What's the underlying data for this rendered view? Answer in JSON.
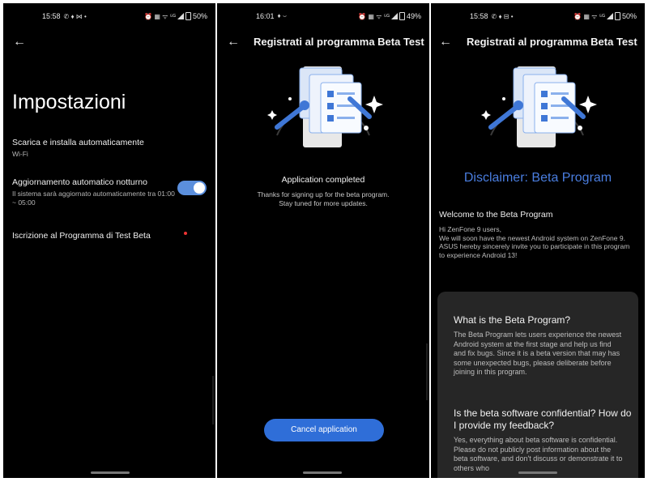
{
  "panel1": {
    "status": {
      "time": "15:58",
      "left_icons": "✆ ♦ ⋈ •",
      "right_icons": "⏰ ▦ ᯤ ⁵ᴳ",
      "battery": "50%"
    },
    "page_title": "Impostazioni",
    "settings": [
      {
        "title": "Scarica e installa automaticamente",
        "subtitle": "Wi-Fi"
      },
      {
        "title": "Aggiornamento automatico notturno",
        "subtitle": "Il sistema sarà aggiornato automaticamente tra 01:00 ~ 05:00",
        "toggle_on": true
      },
      {
        "title": "Iscrizione al Programma di Test Beta"
      }
    ]
  },
  "panel2": {
    "status": {
      "time": "16:01",
      "left_icons": "♦ ⌣",
      "right_icons": "⏰ ▦ ᯤ ⁵ᴳ",
      "battery": "49%"
    },
    "header": "Registrati al programma Beta Test",
    "completed_title": "Application completed",
    "completed_line1": "Thanks for signing up for the beta program.",
    "completed_line2": "Stay tuned for more updates.",
    "cancel_label": "Cancel application"
  },
  "panel3": {
    "status": {
      "time": "15:58",
      "left_icons": "✆ ♦ ⊟ •",
      "right_icons": "⏰ ▦ ᯤ ⁵ᴳ",
      "battery": "50%"
    },
    "header": "Registrati al programma Beta Test",
    "disclaimer": "Disclaimer: Beta Program",
    "welcome_title": "Welcome to the Beta Program",
    "welcome_line1": "Hi ZenFone 9 users,",
    "welcome_line2": "We will soon have the newest Android system on ZenFone 9.",
    "welcome_line3": "ASUS hereby sincerely invite you to participate in this program to experience Android 13!",
    "q1_title": "What is the Beta Program?",
    "q1_body": "The Beta Program lets users experience the newest Android system at the first stage and help us find and fix bugs. Since it is a beta version that may has some unexpected bugs, please deliberate before joining in this program.",
    "q2_title": "Is the beta software confidential? How do I provide my feedback?",
    "q2_body": "Yes, everything about beta software is confidential. Please do not publicly post information about the beta software, and don't discuss or demonstrate it to others who"
  },
  "colors": {
    "toggle": "#5b8fdd",
    "button": "#2f6ed8",
    "disclaimer": "#4a7ee0",
    "card": "#262626",
    "dot": "#e33333"
  },
  "icons": {
    "back": "arrow-left-icon",
    "illustration": "beta-clipboard-illustration"
  }
}
